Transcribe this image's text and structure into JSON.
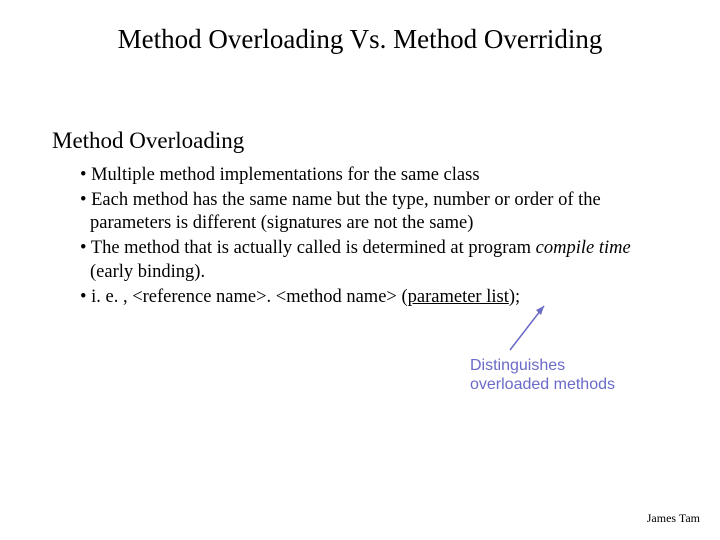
{
  "title": "Method Overloading Vs. Method Overriding",
  "section": "Method Overloading",
  "bullets_html": {
    "b1": "• Multiple method implementations for the same class",
    "b2": "• Each method has the same name but the type, number or order of the parameters is different (signatures are not the same)",
    "b3_prefix": "• The method that is actually called is determined at program ",
    "b3_italic": "compile time",
    "b3_suffix": " (early binding).",
    "b4_prefix": "• i. e. , <reference name>. <method name> (",
    "b4_underline": "parameter list",
    "b4_suffix": ");"
  },
  "annotation_line1": "Distinguishes",
  "annotation_line2": "overloaded methods",
  "footer": "James Tam"
}
